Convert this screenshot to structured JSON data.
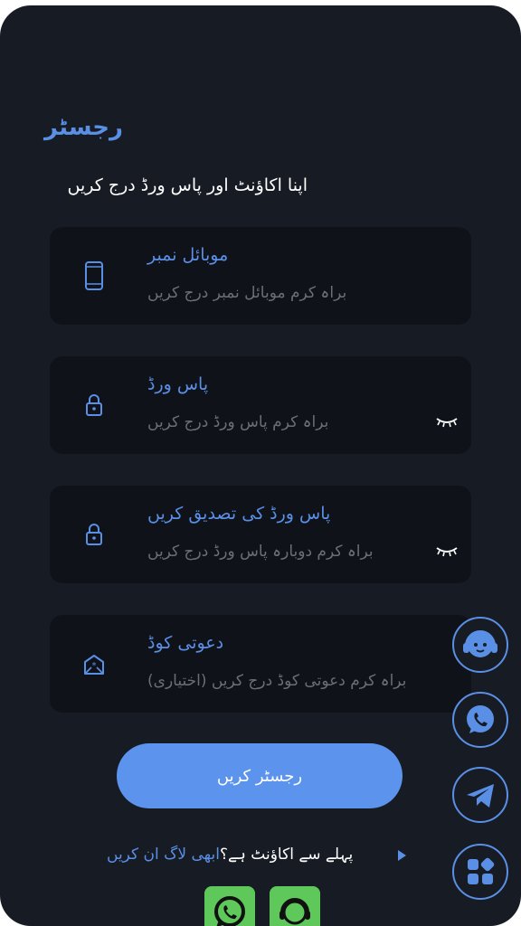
{
  "header": {
    "title": "رجسٹر",
    "subtitle": "اپنا اکاؤنٹ اور پاس ورڈ درج کریں"
  },
  "fields": {
    "mobile": {
      "label": "موبائل نمبر",
      "placeholder": "براہ کرم موبائل نمبر درج کریں",
      "value": ""
    },
    "password": {
      "label": "پاس ورڈ",
      "placeholder": "براہ کرم پاس ورڈ درج کریں",
      "value": ""
    },
    "confirm_password": {
      "label": "پاس ورڈ کی تصدیق کریں",
      "placeholder": "براہ کرم دوبارہ پاس ورڈ درج کریں",
      "value": ""
    },
    "invite_code": {
      "label": "دعوتی کوڈ",
      "placeholder": "براہ کرم دعوتی کوڈ درج کریں (اختیاری)",
      "value": ""
    }
  },
  "actions": {
    "register_label": "رجسٹر کریں"
  },
  "login_prompt": {
    "question": "پہلے سے اکاؤنٹ ہے؟",
    "link": "ابھی لاگ ان کریں"
  },
  "icons": {
    "mobile": "phone-icon",
    "password": "lock-icon",
    "confirm": "lock-icon",
    "invite": "envelope-icon",
    "eye": "eye-closed-icon",
    "float": [
      "headset-icon",
      "whatsapp-icon",
      "telegram-icon",
      "apps-grid-icon"
    ],
    "bottom": [
      "whatsapp-icon",
      "headset-icon"
    ]
  },
  "colors": {
    "background": "#171b24",
    "field_bg": "#0f1219",
    "accent": "#5a8fe6",
    "button": "#5c93ec",
    "app_green": "#5ec85a"
  }
}
